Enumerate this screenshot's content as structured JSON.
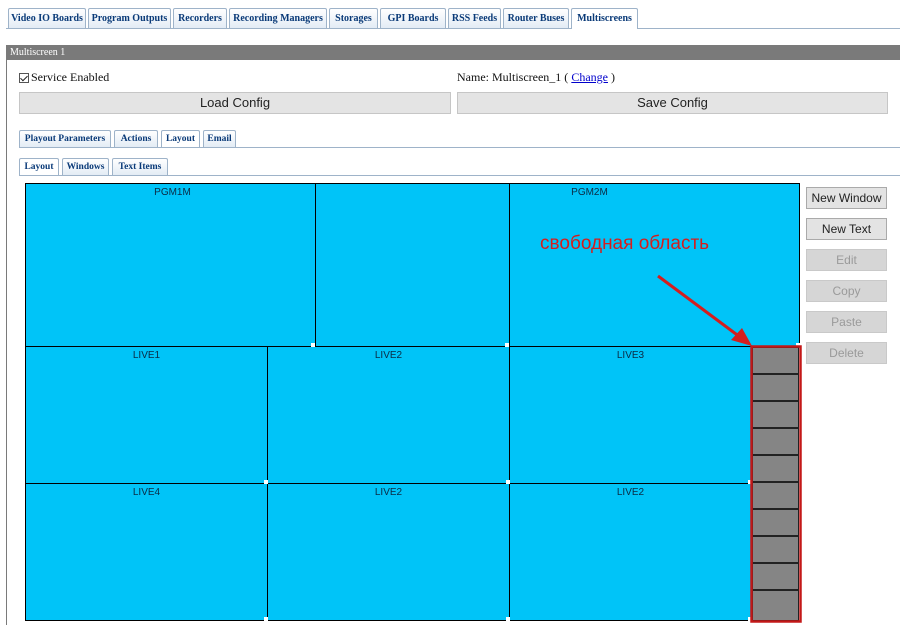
{
  "top_tabs": [
    {
      "label": "Video IO Boards"
    },
    {
      "label": "Program Outputs"
    },
    {
      "label": "Recorders"
    },
    {
      "label": "Recording Managers"
    },
    {
      "label": "Storages"
    },
    {
      "label": "GPI Boards"
    },
    {
      "label": "RSS Feeds"
    },
    {
      "label": "Router Buses"
    },
    {
      "label": "Multiscreens",
      "active": true
    }
  ],
  "panel": {
    "title": "Multiscreen 1",
    "service_enabled_label": "Service Enabled",
    "service_enabled": true,
    "name_prefix": "Name: Multiscreen_1 (",
    "change_link": "Change",
    "name_suffix": ")",
    "load_config_label": "Load Config",
    "save_config_label": "Save Config"
  },
  "settings_tabs": [
    {
      "label": "Playout Parameters"
    },
    {
      "label": "Actions"
    },
    {
      "label": "Layout",
      "active": true
    },
    {
      "label": "Email"
    }
  ],
  "layout_tabs": [
    {
      "label": "Layout",
      "active": true
    },
    {
      "label": "Windows"
    },
    {
      "label": "Text Items"
    }
  ],
  "windows": {
    "pgm1m": "PGM1M",
    "pgm2m": "PGM2M",
    "live1": "LIVE1",
    "live2_top": "LIVE2",
    "live3": "LIVE3",
    "live4": "LIVE4",
    "live2_mid": "LIVE2",
    "live2_right": "LIVE2"
  },
  "annotation": {
    "text": "свободная область",
    "color": "#d41e1e"
  },
  "side_buttons": {
    "new_window": "New Window",
    "new_text": "New Text",
    "edit": "Edit",
    "copy": "Copy",
    "paste": "Paste",
    "delete": "Delete"
  },
  "colors": {
    "window_fill": "#00c4f8",
    "free_area_fill": "#858585",
    "tab_text": "#0a3a78",
    "panel_header": "#7a7a7a"
  }
}
